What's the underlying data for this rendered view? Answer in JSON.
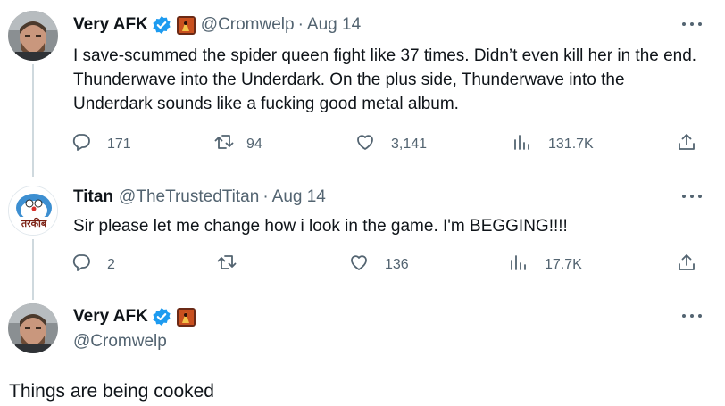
{
  "tweets": [
    {
      "author": "Very AFK",
      "handle": "@Cromwelp",
      "separator": "·",
      "date": "Aug 14",
      "text": "I save-scummed the spider queen fight like 37 times. Didn’t even kill her in the end. Thunderwave into the Underdark. On the plus side, Thunderwave into the Underdark sounds like a fucking good metal album.",
      "replies": "171",
      "retweets": "94",
      "likes": "3,141",
      "views": "131.7K"
    },
    {
      "author": "Titan",
      "handle": "@TheTrustedTitan",
      "separator": "·",
      "date": "Aug 14",
      "text": "Sir please let me change how i look in the game. I'm BEGGING!!!!",
      "replies": "2",
      "retweets": "",
      "likes": "136",
      "views": "17.7K",
      "avatar_text": "तरकीब"
    }
  ],
  "focused": {
    "author": "Very AFK",
    "handle": "@Cromwelp",
    "text": "Things are being cooked"
  },
  "colors": {
    "text": "#0f1419",
    "muted": "#536471",
    "verified": "#1d9bf0",
    "thread_line": "#cfd9de"
  },
  "icons": [
    "verified-badge-icon",
    "reply-icon",
    "retweet-icon",
    "like-icon",
    "views-icon",
    "share-icon",
    "more-icon"
  ]
}
